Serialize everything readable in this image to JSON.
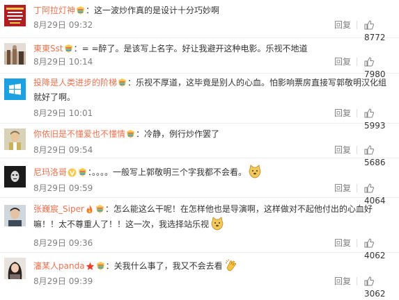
{
  "comments": [
    {
      "username": "丁阿拉灯神",
      "separator": "：",
      "text": "这一波炒作真的是设计十分巧妙啊",
      "time": "8月29日 09:32",
      "reply_label": "回复",
      "likes": "8772",
      "avatar_icon": "manchester-united-crest-avatar"
    },
    {
      "username": "東東Sst",
      "separator": "：",
      "text": "= =醉了。是该写上名字。好让我避开这种电影。乐视不地道",
      "time": "8月29日 10:14",
      "reply_label": "回复",
      "likes": "7980",
      "avatar_icon": "street-photo-avatar"
    },
    {
      "username": "投降是人类进步的阶梯",
      "separator": "：",
      "text": "乐视不厚道，这毕竟是别人的心血。怕影响票房直接写郭敬明汉化组就好了啊。",
      "time": "8月29日 10:01",
      "reply_label": "回复",
      "likes": "5993",
      "avatar_icon": "windows-logo-avatar"
    },
    {
      "username": "你依旧是不懂爱也不懂情",
      "separator": "：",
      "text": "冷静，例行炒作罢了",
      "time": "8月29日 09:54",
      "reply_label": "回复",
      "likes": "5686",
      "avatar_icon": "portrait-avatar"
    },
    {
      "username": "尼玛洛哥",
      "separator": "：",
      "text": "。。。。一般写上郭敬明三个字我都不会看。",
      "time": "8月29日 09:59",
      "reply_label": "回复",
      "likes": "4064",
      "avatar_icon": "dark-mask-avatar"
    },
    {
      "username": "张巍宸_Siper",
      "separator": "：",
      "text": "怎么能这么干呢！在怎样他也是导演啊，这样做对不起他付出的心血好嘛！！太不尊重人了！！这一次，我选择站乐视",
      "time": "8月29日 09:36",
      "reply_label": "回复",
      "likes": "4062",
      "avatar_icon": "man-portrait-avatar"
    },
    {
      "username": "瀋某人panda",
      "separator": "：",
      "text": "关我什么事了，我又不会去看",
      "time": "8月29日 09:39",
      "reply_label": "回复",
      "likes": "3062",
      "avatar_icon": "woman-portrait-avatar"
    }
  ],
  "colors": {
    "username": "#eb7350",
    "text": "#333333",
    "meta": "#808080",
    "divider": "#eeeeee"
  }
}
